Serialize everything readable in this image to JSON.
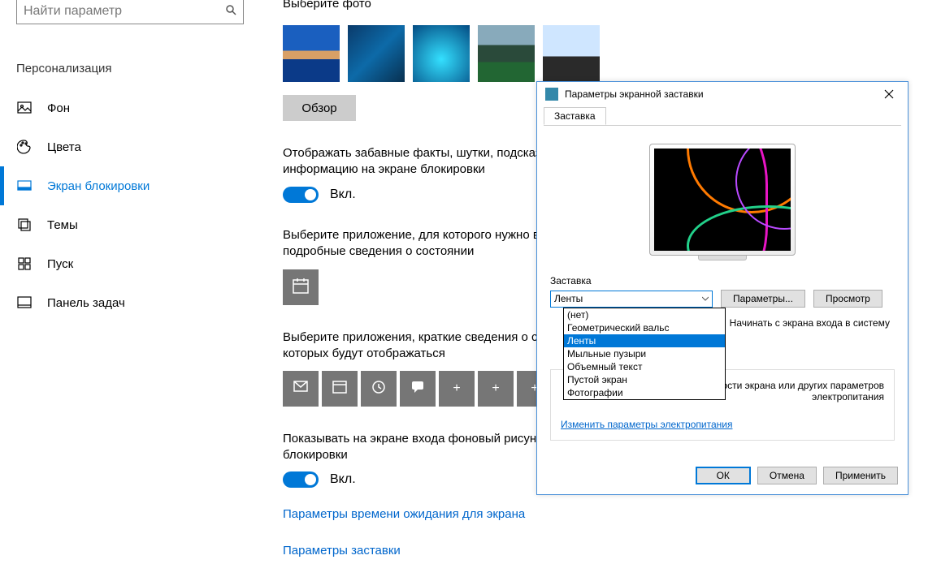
{
  "search": {
    "placeholder": "Найти параметр"
  },
  "navTitle": "Персонализация",
  "nav": [
    {
      "label": "Фон"
    },
    {
      "label": "Цвета"
    },
    {
      "label": "Экран блокировки"
    },
    {
      "label": "Темы"
    },
    {
      "label": "Пуск"
    },
    {
      "label": "Панель задач"
    }
  ],
  "content": {
    "choosePhoto": "Выберите фото",
    "browse": "Обзор",
    "funFacts": "Отображать забавные факты, шутки, подсказки и другую информацию на экране блокировки",
    "on": "Вкл.",
    "chooseAppDetailed": "Выберите приложение, для которого нужно выводить подробные сведения о состоянии",
    "chooseAppsBrief": "Выберите приложения, краткие сведения о состоянии которых будут отображаться",
    "showBgSignIn": "Показывать на экране входа фоновый рисунок экрана блокировки",
    "linkTimeout": "Параметры времени ожидания для экрана",
    "linkScreensaver": "Параметры заставки"
  },
  "dialog": {
    "title": "Параметры экранной заставки",
    "tab": "Заставка",
    "group": "Заставка",
    "selected": "Ленты",
    "options": [
      "(нет)",
      "Геометрический вальс",
      "Ленты",
      "Мыльные пузыри",
      "Объемный текст",
      "Пустой экран",
      "Фотографии"
    ],
    "paramsBtn": "Параметры...",
    "previewBtn": "Просмотр",
    "resumeText": "Начинать с экрана входа в систему",
    "powerHint": "Для изменения яркости экрана или других параметров электропитания",
    "powerLink": "Изменить параметры электропитания",
    "ok": "ОК",
    "cancel": "Отмена",
    "apply": "Применить"
  }
}
